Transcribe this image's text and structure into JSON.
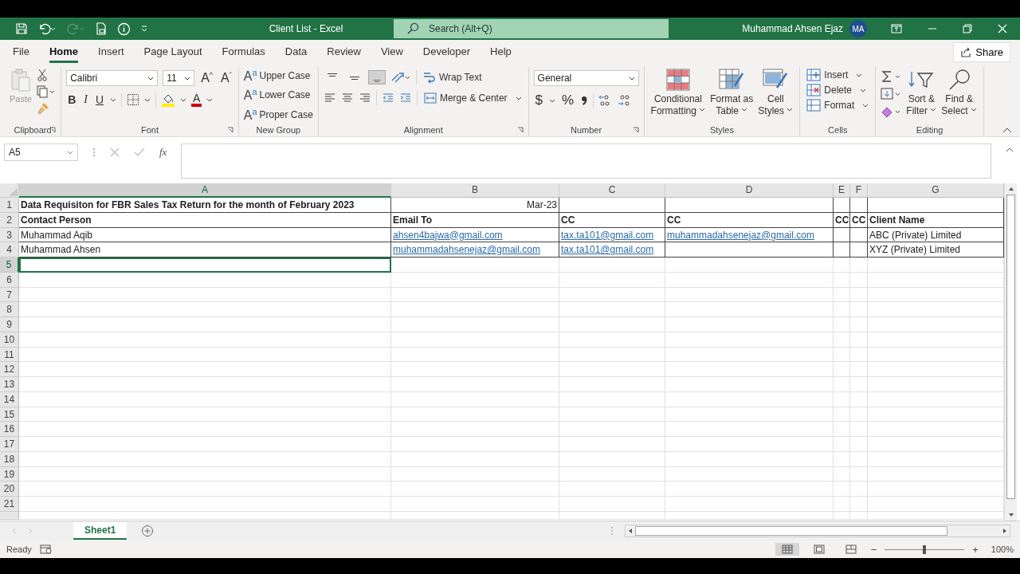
{
  "title_bar": {
    "document_title": "Client List  -  Excel",
    "search": {
      "placeholder": "Search (Alt+Q)"
    },
    "user_name": "Muhammad Ahsen Ejaz",
    "user_initials": "MA",
    "redo_disabled": true
  },
  "menu_tabs": [
    {
      "label": "File",
      "selected": false
    },
    {
      "label": "Home",
      "selected": true
    },
    {
      "label": "Insert",
      "selected": false
    },
    {
      "label": "Page Layout",
      "selected": false
    },
    {
      "label": "Formulas",
      "selected": false
    },
    {
      "label": "Data",
      "selected": false
    },
    {
      "label": "Review",
      "selected": false
    },
    {
      "label": "View",
      "selected": false
    },
    {
      "label": "Developer",
      "selected": false
    },
    {
      "label": "Help",
      "selected": false
    }
  ],
  "share_button": "Share",
  "ribbon": {
    "clipboard": {
      "label": "Clipboard",
      "paste": "Paste"
    },
    "font": {
      "label": "Font",
      "font_name": "Calibri",
      "font_size": "11",
      "grow": "A",
      "grow_mark": "^",
      "shrink": "A",
      "shrink_mark": "ˇ",
      "bold": "B",
      "italic": "I",
      "underline": "U",
      "font_color": "A"
    },
    "new_group": {
      "label": "New Group",
      "buttons": [
        {
          "glyph": "A$^{a}$",
          "label": "Upper Case"
        },
        {
          "glyph": "A$^{a}$",
          "label": "Lower Case"
        },
        {
          "glyph": "A$^{a}$",
          "label": "Proper Case"
        }
      ]
    },
    "alignment": {
      "label": "Alignment",
      "vertical": [
        {
          "selected": false
        },
        {
          "selected": false
        },
        {
          "selected": true
        }
      ],
      "wrap_text": "Wrap Text",
      "merge_center": "Merge & Center"
    },
    "number": {
      "label": "Number",
      "format": "General",
      "currency": "$",
      "percent": "%"
    },
    "styles": {
      "label": "Styles",
      "buttons": [
        {
          "kind": "conditional",
          "line1": "Conditional",
          "line2": "Formatting"
        },
        {
          "kind": "table",
          "line1": "Format as",
          "line2": "Table"
        },
        {
          "kind": "cellstyles",
          "line1": "Cell",
          "line2": "Styles"
        }
      ]
    },
    "cells": {
      "label": "Cells",
      "buttons": [
        {
          "kind": "insert",
          "label": "Insert"
        },
        {
          "kind": "delete",
          "label": "Delete"
        },
        {
          "kind": "format",
          "label": "Format"
        }
      ]
    },
    "editing": {
      "label": "Editing",
      "buttons": [
        {
          "kind": "sort",
          "line1": "Sort &",
          "line2": "Filter"
        },
        {
          "kind": "find",
          "line1": "Find &",
          "line2": "Select"
        }
      ]
    }
  },
  "formula_bar": {
    "name_box": "A5",
    "function_label": "fx"
  },
  "sheet": {
    "columns": [
      {
        "label": "A",
        "selected": true
      },
      {
        "label": "B",
        "selected": false
      },
      {
        "label": "C",
        "selected": false
      },
      {
        "label": "D",
        "selected": false
      },
      {
        "label": "E",
        "selected": false
      },
      {
        "label": "F",
        "selected": false
      },
      {
        "label": "G",
        "selected": false
      }
    ],
    "rows": [
      {
        "number": "1",
        "selected": false,
        "bordered": true,
        "cells": [
          {
            "text": "Data Requisiton for FBR Sales Tax Return for the month of February 2023",
            "kind": "header"
          },
          {
            "text": "Mar-23",
            "kind": "date"
          },
          null,
          null,
          null,
          null,
          null
        ]
      },
      {
        "number": "2",
        "selected": false,
        "bordered": true,
        "cells": [
          {
            "text": "Contact Person",
            "kind": "header"
          },
          {
            "text": "Email To",
            "kind": "header"
          },
          {
            "text": "CC",
            "kind": "header"
          },
          {
            "text": "CC",
            "kind": "header"
          },
          {
            "text": "CC",
            "kind": "header"
          },
          {
            "text": "CC",
            "kind": "header"
          },
          {
            "text": "Client Name",
            "kind": "header"
          }
        ]
      },
      {
        "number": "3",
        "selected": false,
        "bordered": true,
        "cells": [
          {
            "text": "Muhammad Aqib",
            "kind": "text"
          },
          {
            "text": "ahsen4bajwa@gmail.com",
            "kind": "link"
          },
          {
            "text": "tax.ta101@gmail.com",
            "kind": "link"
          },
          {
            "text": "muhammadahsenejaz@gmail.com",
            "kind": "link"
          },
          null,
          null,
          {
            "text": "ABC (Private) Limited",
            "kind": "text"
          }
        ]
      },
      {
        "number": "4",
        "selected": false,
        "bordered": true,
        "cells": [
          {
            "text": "Muhammad Ahsen",
            "kind": "text"
          },
          {
            "text": "muhammadahsenejaz@gmail.com",
            "kind": "link"
          },
          {
            "text": "tax.ta101@gmail.com",
            "kind": "link"
          },
          null,
          null,
          null,
          {
            "text": "XYZ (Private) Limited",
            "kind": "text"
          }
        ]
      },
      {
        "number": "5",
        "selected": true,
        "bordered": false
      },
      {
        "number": "6",
        "selected": false,
        "bordered": false
      },
      {
        "number": "7",
        "selected": false,
        "bordered": false
      },
      {
        "number": "8",
        "selected": false,
        "bordered": false
      },
      {
        "number": "9",
        "selected": false,
        "bordered": false
      },
      {
        "number": "10",
        "selected": false,
        "bordered": false
      },
      {
        "number": "11",
        "selected": false,
        "bordered": false
      },
      {
        "number": "12",
        "selected": false,
        "bordered": false
      },
      {
        "number": "13",
        "selected": false,
        "bordered": false
      },
      {
        "number": "14",
        "selected": false,
        "bordered": false
      },
      {
        "number": "15",
        "selected": false,
        "bordered": false
      },
      {
        "number": "16",
        "selected": false,
        "bordered": false
      },
      {
        "number": "17",
        "selected": false,
        "bordered": false
      },
      {
        "number": "18",
        "selected": false,
        "bordered": false
      },
      {
        "number": "19",
        "selected": false,
        "bordered": false
      },
      {
        "number": "20",
        "selected": false,
        "bordered": false
      },
      {
        "number": "21",
        "selected": false,
        "bordered": false
      }
    ]
  },
  "sheet_tabs": [
    {
      "label": "Sheet1",
      "selected": true
    }
  ],
  "status_bar": {
    "status": "Ready",
    "views": [
      {
        "kind": "normal",
        "selected": true
      },
      {
        "kind": "layout",
        "selected": false
      },
      {
        "kind": "break",
        "selected": false
      }
    ],
    "zoom_out": "−",
    "zoom_in": "+",
    "zoom": {
      "level": 0.5
    },
    "zoom_text": "100%"
  }
}
